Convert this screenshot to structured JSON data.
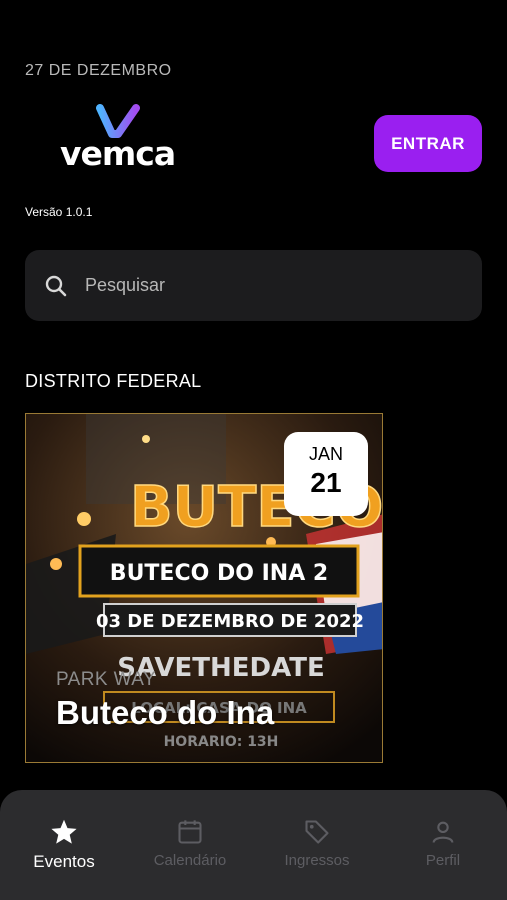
{
  "header": {
    "date": "27 DE DEZEMBRO",
    "brand": "vemca",
    "version": "Versão 1.0.1",
    "login_label": "ENTRAR",
    "brand_gradient": [
      "#4fb3ff",
      "#a34cf0"
    ]
  },
  "search": {
    "placeholder": "Pesquisar",
    "icon": "search-icon"
  },
  "section": {
    "region": "DISTRITO FEDERAL"
  },
  "event": {
    "month": "JAN",
    "day": "21",
    "venue": "PARK WAY",
    "name": "Buteco do Ina",
    "poster": {
      "headline": "BUTECO",
      "title": "BUTECO DO INA 2",
      "date_line": "03 DE DEZEMBRO DE 2022",
      "save": "SAVETHEDATE",
      "local": "LOCAL: CASA DO INA",
      "horario": "HORARIO: 13H"
    }
  },
  "tabs": [
    {
      "label": "Eventos",
      "icon": "star-icon",
      "active": true
    },
    {
      "label": "Calendário",
      "icon": "calendar-icon",
      "active": false
    },
    {
      "label": "Ingressos",
      "icon": "tag-icon",
      "active": false
    },
    {
      "label": "Perfil",
      "icon": "person-icon",
      "active": false
    }
  ],
  "colors": {
    "accent": "#9a1ff0",
    "background": "#000000",
    "surface": "#1c1c1e",
    "nav": "#2c2c2e"
  }
}
